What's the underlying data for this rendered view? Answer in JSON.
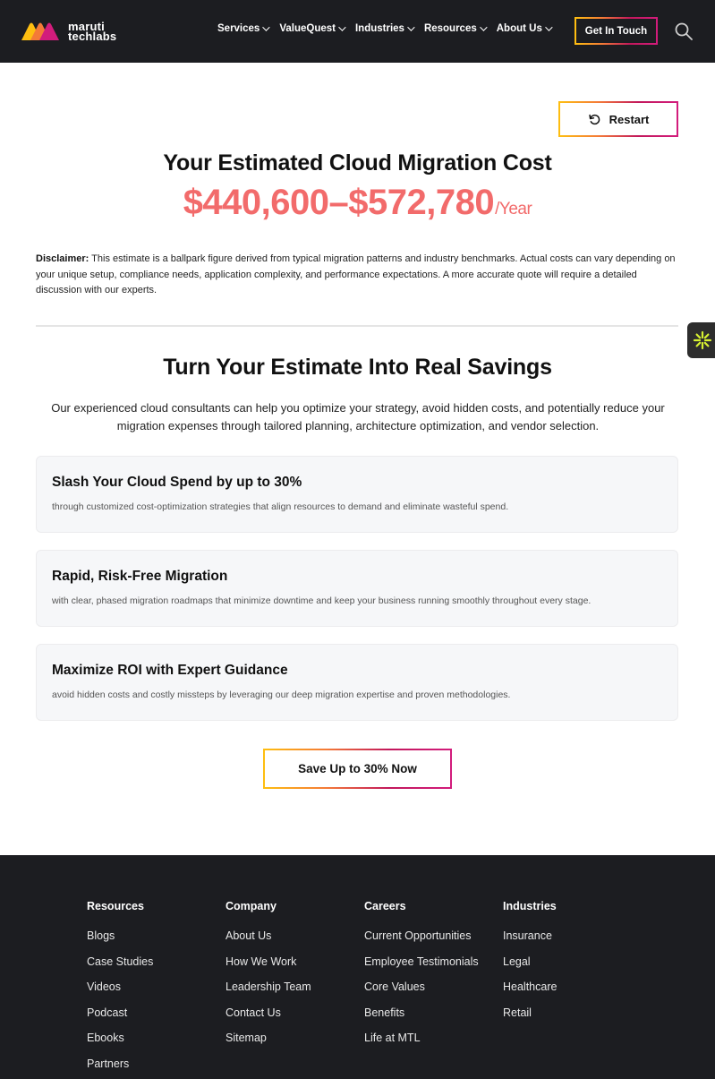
{
  "header": {
    "logo_line1": "maruti",
    "logo_line2": "techlabs",
    "nav": [
      {
        "label": "Services"
      },
      {
        "label": "ValueQuest"
      },
      {
        "label": "Industries"
      },
      {
        "label": "Resources"
      },
      {
        "label": "About Us"
      }
    ],
    "cta_label": "Get In Touch",
    "search_icon": "search-icon"
  },
  "estimate": {
    "restart_label": "Restart",
    "title": "Your Estimated Cloud Migration Cost",
    "price_low": "$440,600",
    "price_sep": "–",
    "price_high": "$572,780",
    "price_unit": "/Year",
    "disclaimer_label": "Disclaimer:",
    "disclaimer_text": "This estimate is a ballpark figure derived from typical migration patterns and industry benchmarks. Actual costs can vary depending on your unique setup, compliance needs, application complexity, and performance expectations. A more accurate quote will require a detailed discussion with our experts."
  },
  "savings": {
    "title": "Turn Your Estimate Into Real Savings",
    "description": "Our experienced cloud consultants can help you optimize your strategy, avoid hidden costs, and potentially reduce your migration expenses through tailored planning, architecture optimization, and vendor selection.",
    "cards": [
      {
        "title": "Slash Your Cloud Spend by up to 30%",
        "desc": "through customized cost-optimization strategies that align resources to demand and eliminate wasteful spend."
      },
      {
        "title": "Rapid, Risk-Free Migration",
        "desc": "with clear, phased migration roadmaps that minimize downtime and keep your business running smoothly throughout every stage."
      },
      {
        "title": "Maximize ROI with Expert Guidance",
        "desc": "avoid hidden costs and costly missteps by leveraging our deep migration expertise and proven methodologies."
      }
    ],
    "cta_label": "Save Up to 30% Now"
  },
  "footer": {
    "columns": [
      {
        "title": "Resources",
        "links": [
          "Blogs",
          "Case Studies",
          "Videos",
          "Podcast",
          "Ebooks",
          "Partners"
        ]
      },
      {
        "title": "Company",
        "links": [
          "About Us",
          "How We Work",
          "Leadership Team",
          "Contact Us",
          "Sitemap"
        ]
      },
      {
        "title": "Careers",
        "links": [
          "Current Opportunities",
          "Employee Testimonials",
          "Core Values",
          "Benefits",
          "Life at MTL"
        ]
      },
      {
        "title": "Industries",
        "links": [
          "Insurance",
          "Legal",
          "Healthcare",
          "Retail"
        ]
      }
    ]
  },
  "colors": {
    "nav_bg": "#1c1d21",
    "price": "#f26b6b",
    "card_bg": "#f6f7f9"
  }
}
